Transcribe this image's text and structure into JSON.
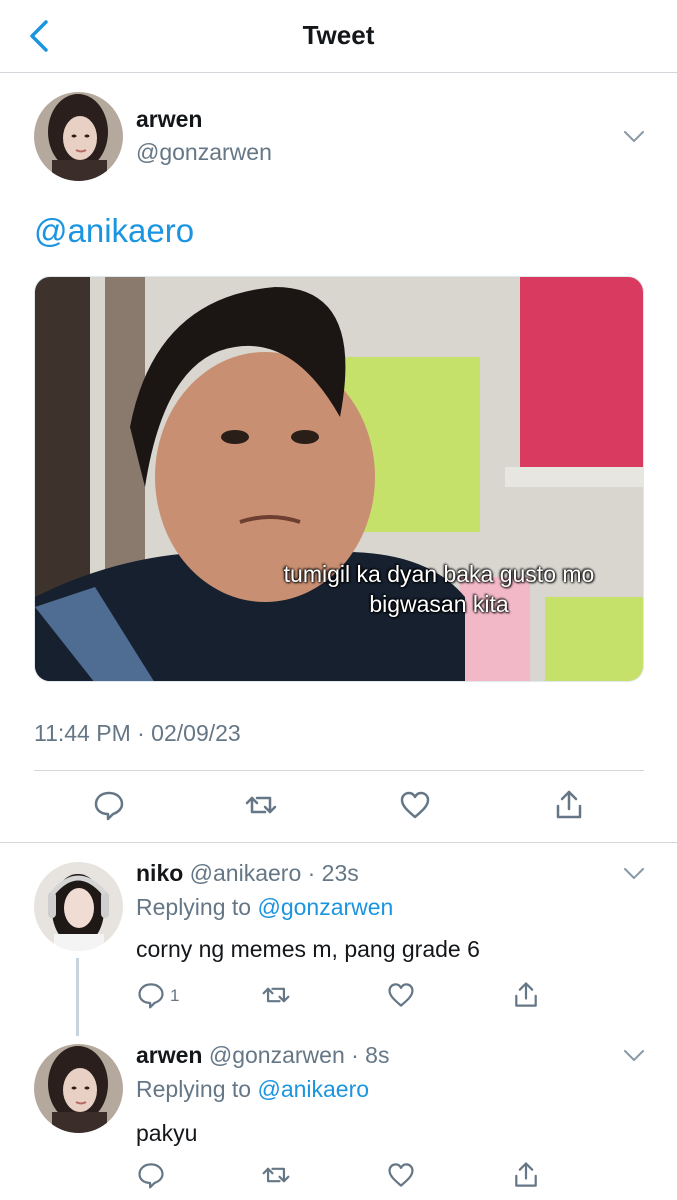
{
  "header": {
    "title": "Tweet"
  },
  "tweet": {
    "name": "arwen",
    "handle": "@gonzarwen",
    "text": "@anikaero",
    "media_caption_line1": "tumigil ka dyan baka gusto mo",
    "media_caption_line2": "bigwasan kita",
    "timestamp": "11:44 PM · 02/09/23"
  },
  "replies": [
    {
      "name": "niko",
      "meta": "@anikaero · 23s",
      "replying_prefix": "Replying to ",
      "replying_to": "@gonzarwen",
      "text": "corny ng memes m, pang grade 6",
      "reply_count": "1"
    },
    {
      "name": "arwen",
      "meta": "@gonzarwen · 8s",
      "replying_prefix": "Replying to ",
      "replying_to": "@anikaero",
      "text": "pakyu"
    }
  ],
  "colors": {
    "accent": "#1b95e0",
    "muted": "#657786",
    "text": "#14171a",
    "divider": "#d3d7db"
  },
  "icons": [
    "chevron-left-icon",
    "chevron-down-icon",
    "reply-icon",
    "retweet-icon",
    "like-icon",
    "share-icon"
  ]
}
